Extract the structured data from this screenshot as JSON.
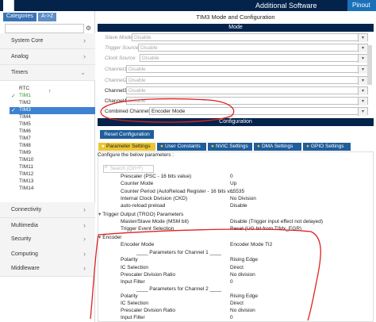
{
  "topbar": {
    "additional_software": "Additional Software",
    "pinout": "Pinout"
  },
  "sidebar": {
    "tabs": [
      "Categories",
      "A->Z"
    ],
    "categories": [
      {
        "label": "System Core"
      },
      {
        "label": "Analog"
      },
      {
        "label": "Timers"
      },
      {
        "label": "Connectivity"
      },
      {
        "label": "Multimedia"
      },
      {
        "label": "Security"
      },
      {
        "label": "Computing"
      },
      {
        "label": "Middleware"
      }
    ],
    "peripherals": [
      {
        "label": "RTC",
        "checked": false
      },
      {
        "label": "TIM1",
        "checked": true
      },
      {
        "label": "TIM2",
        "checked": false
      },
      {
        "label": "TIM3",
        "checked": true,
        "selected": true
      },
      {
        "label": "TIM4",
        "checked": false
      },
      {
        "label": "TIM5",
        "checked": false
      },
      {
        "label": "TIM6",
        "checked": false
      },
      {
        "label": "TIM7",
        "checked": false
      },
      {
        "label": "TIM8",
        "checked": false
      },
      {
        "label": "TIM9",
        "checked": false
      },
      {
        "label": "TIM10",
        "checked": false
      },
      {
        "label": "TIM11",
        "checked": false
      },
      {
        "label": "TIM12",
        "checked": false
      },
      {
        "label": "TIM13",
        "checked": false
      },
      {
        "label": "TIM14",
        "checked": false
      }
    ]
  },
  "main": {
    "title": "TIM3 Mode and Configuration",
    "mode_header": "Mode",
    "mode_rows": [
      {
        "label": "Slave Mode",
        "value": "Disable",
        "active": false
      },
      {
        "label": "Trigger Source",
        "value": "Disable",
        "active": false
      },
      {
        "label": "Clock Source",
        "value": "Disable",
        "active": false
      },
      {
        "label": "Channel1",
        "value": "Disable",
        "active": false
      },
      {
        "label": "Channel2",
        "value": "Disable",
        "active": false
      },
      {
        "label": "Channel3",
        "value": "Disable",
        "active": true
      },
      {
        "label": "Channel4",
        "value": "Disable",
        "active": true
      },
      {
        "label": "Combined Channels",
        "value": "Encoder Mode",
        "active": true
      }
    ],
    "config_header": "Configuration",
    "reset_button": "Reset Configuration",
    "config_tabs": [
      "Parameter Settings",
      "User Constants",
      "NVIC Settings",
      "DMA Settings",
      "GPIO Settings"
    ],
    "config_text": "Configure the below parameters :",
    "search_placeholder": "Search (Ctrl+F)",
    "params_top": [
      {
        "name": "Prescaler (PSC - 16 bits value)",
        "value": "0"
      },
      {
        "name": "Counter Mode",
        "value": "Up"
      },
      {
        "name": "Counter Period (AutoReload Register - 16 bits v...",
        "value": "65535"
      },
      {
        "name": "Internal Clock Division (CKD)",
        "value": "No Division"
      },
      {
        "name": "auto-reload preload",
        "value": "Disable"
      }
    ],
    "trgo_header": "Trigger Output (TRGO) Parameters",
    "trgo_params": [
      {
        "name": "Master/Slave Mode (MSM bit)",
        "value": "Disable (Trigger input effect not delayed)"
      },
      {
        "name": "Trigger Event Selection",
        "value": "Reset (UG bit from TIMx_EGR)"
      }
    ],
    "encoder_header": "Encoder",
    "encoder_params": [
      {
        "name": "Encoder Mode",
        "value": "Encoder Mode TI2"
      },
      {
        "name": "____ Parameters for Channel 1 ____",
        "value": ""
      },
      {
        "name": "Polarity",
        "value": "Rising Edge"
      },
      {
        "name": "IC Selection",
        "value": "Direct"
      },
      {
        "name": "Prescaler Division Ratio",
        "value": "No division"
      },
      {
        "name": "Input Filter",
        "value": "0"
      },
      {
        "name": "____ Parameters for Channel 2 ____",
        "value": ""
      },
      {
        "name": "Polarity",
        "value": "Rising Edge"
      },
      {
        "name": "IC Selection",
        "value": "Direct"
      },
      {
        "name": "Prescaler Division Ratio",
        "value": "No division"
      },
      {
        "name": "Input Filter",
        "value": "0"
      }
    ]
  },
  "icons": {
    "gear": "gear-icon",
    "chevron": "chevron-right-icon",
    "check": "check-icon",
    "search": "search-icon"
  },
  "colors": {
    "navy": "#03234b",
    "selected": "#3c82d0",
    "tab_active": "#ecc632",
    "annotation": "#e02020"
  }
}
